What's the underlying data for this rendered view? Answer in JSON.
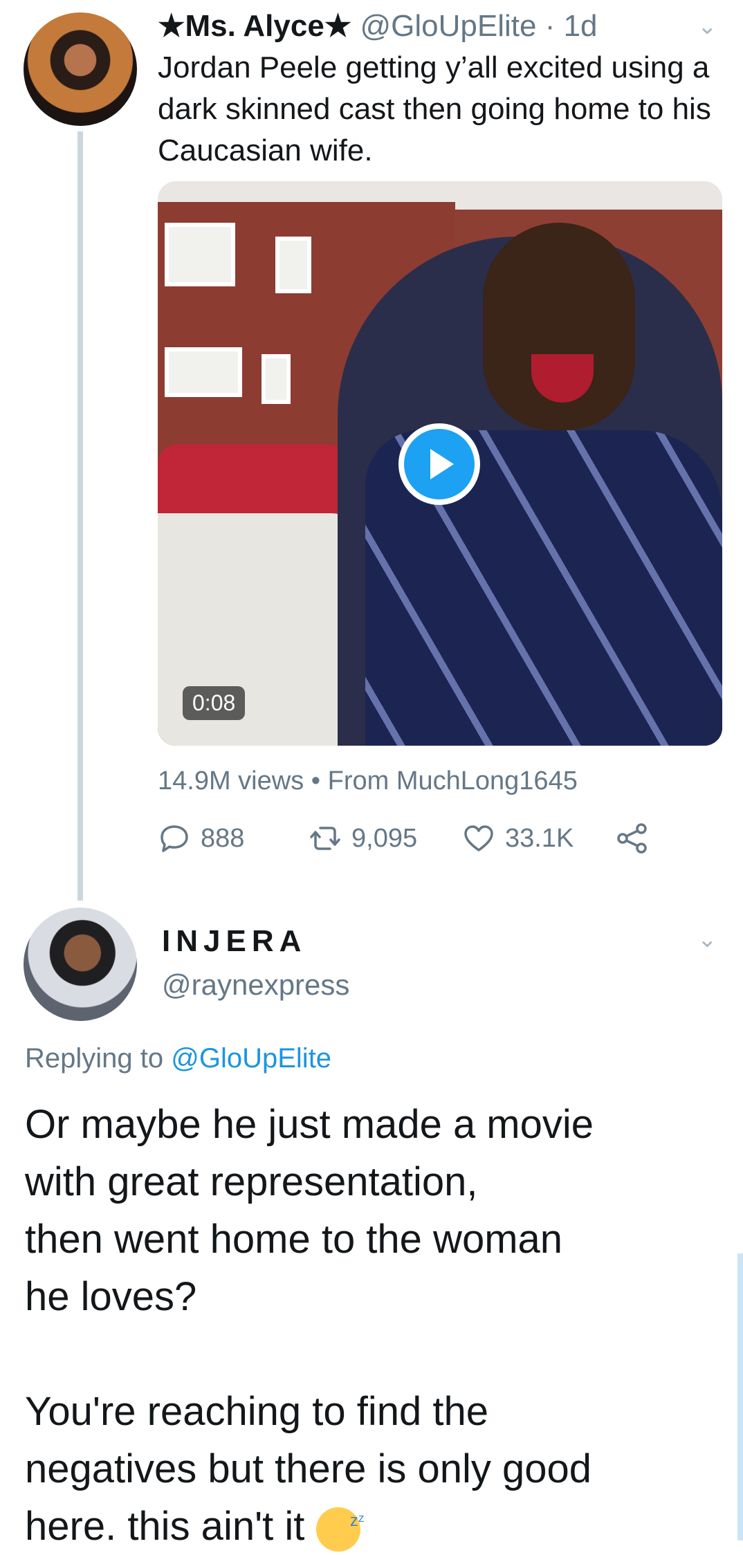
{
  "tweet": {
    "author_name": "★Ms. Alyce★",
    "handle": "@GloUpElite",
    "time": "· 1d",
    "text": "Jordan Peele getting y’all excited using a dark skinned cast then going home to his Caucasian wife.",
    "video_duration": "0:08",
    "views": "14.9M views",
    "from": "• From MuchLong1645",
    "replies": "888",
    "retweets": "9,095",
    "likes": "33.1K"
  },
  "reply": {
    "author_name": "INJERA",
    "handle": "@raynexpress",
    "replying_prefix": "Replying to",
    "replying_to": "@GloUpElite",
    "text_main": "Or maybe he just made a movie\nwith great representation,\nthen went home to the woman\nhe loves?\n\nYou're reaching to find the\nnegatives but there is only good\nhere. this ain't it"
  },
  "icons": {
    "caret": "chevron-down-icon",
    "reply": "reply-icon",
    "retweet": "retweet-icon",
    "like": "heart-icon",
    "share": "share-icon",
    "play": "play-icon",
    "emoji": "sleeping-face-icon"
  },
  "colors": {
    "accent": "#1da1f2",
    "secondary_text": "#657786",
    "thread_line": "#ccd6dd"
  }
}
